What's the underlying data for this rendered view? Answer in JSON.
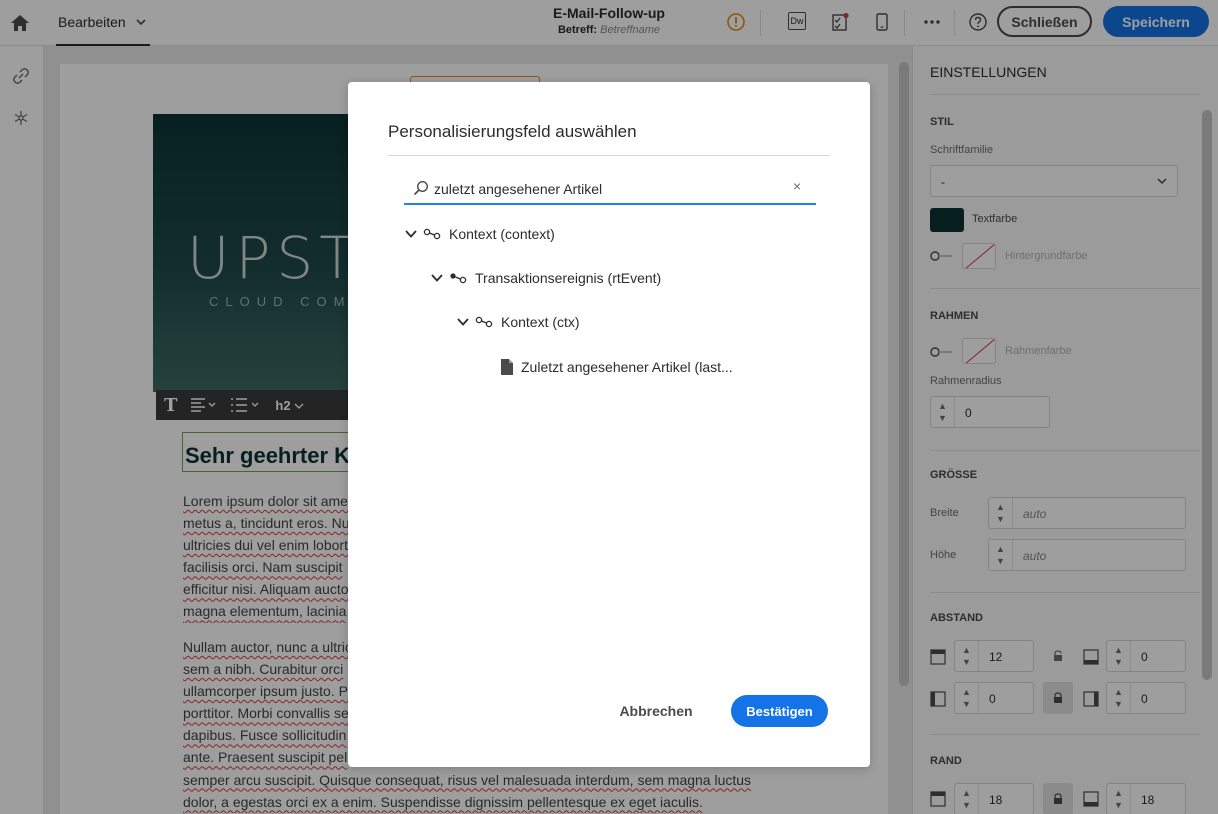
{
  "topbar": {
    "edit_menu_label": "Bearbeiten",
    "title": "E-Mail-Follow-up",
    "subject_label": "Betreff:",
    "subject_value": "Betreffname",
    "dw_label": "Dw",
    "close_label": "Schließen",
    "save_label": "Speichern",
    "icons": [
      "home-icon",
      "chevron-down-icon",
      "warning-icon",
      "dreamweaver-icon",
      "checklist-icon",
      "mobile-icon",
      "more-icon",
      "help-icon"
    ]
  },
  "rail": {
    "icons": [
      "link-icon",
      "snowflake-icon"
    ]
  },
  "canvas": {
    "hero_logo": "UPSTA",
    "hero_logo_sub": "CLOUD COM",
    "toolbar": {
      "heading_level": "h2"
    },
    "heading": "Sehr geehrter K",
    "paragraph1": [
      "Lorem ipsum dolor sit ame",
      "metus a, tincidunt eros. Nu",
      "ultricies dui vel enim lobort",
      "facilisis orci. Nam suscipit",
      "efficitur nisi. Aliquam aucto",
      "magna elementum, lacinia"
    ],
    "paragraph2": [
      "Nullam auctor, nunc a ultric",
      "sem a nibh. Curabitur orci",
      "ullamcorper ipsum justo. P",
      "porttitor. Morbi convallis se",
      "dapibus. Fusce sollicitudin",
      "ante. Praesent suscipit pel",
      "semper arcu suscipit. Quisque consequat, risus vel malesuada interdum, sem magna luctus",
      "dolor, a egestas orci ex a enim. Suspendisse dignissim pellentesque ex eget iaculis."
    ]
  },
  "panel": {
    "title": "EINSTELLUNGEN",
    "style": {
      "section": "STIL",
      "font_family_label": "Schriftfamilie",
      "font_family_value": "-",
      "text_color_label": "Textfarbe",
      "bg_color_label": "Hintergrundfarbe",
      "text_color": "#0d3334"
    },
    "border": {
      "section": "RAHMEN",
      "border_color_label": "Rahmenfarbe",
      "radius_label": "Rahmenradius",
      "radius_value": "0"
    },
    "size": {
      "section": "GRÖSSE",
      "width_label": "Breite",
      "width_value": "auto",
      "height_label": "Höhe",
      "height_value": "auto"
    },
    "spacing": {
      "section": "ABSTAND",
      "top": "12",
      "bottom": "0",
      "left": "0",
      "right": "0"
    },
    "margin": {
      "section": "RAND",
      "top": "18",
      "bottom": "18"
    }
  },
  "dialog": {
    "title": "Personalisierungsfeld auswählen",
    "search_value": "zuletzt angesehener Artikel",
    "clear_label": "×",
    "tree": [
      {
        "label": "Kontext (context)",
        "type": "node",
        "level": 0
      },
      {
        "label": "Transaktionsereignis (rtEvent)",
        "type": "node",
        "level": 1
      },
      {
        "label": "Kontext (ctx)",
        "type": "node",
        "level": 2
      },
      {
        "label": "Zuletzt angesehener Artikel (last...",
        "type": "leaf",
        "level": 3
      }
    ],
    "cancel_label": "Abbrechen",
    "confirm_label": "Bestätigen",
    "accent_color": "#1473e6"
  }
}
